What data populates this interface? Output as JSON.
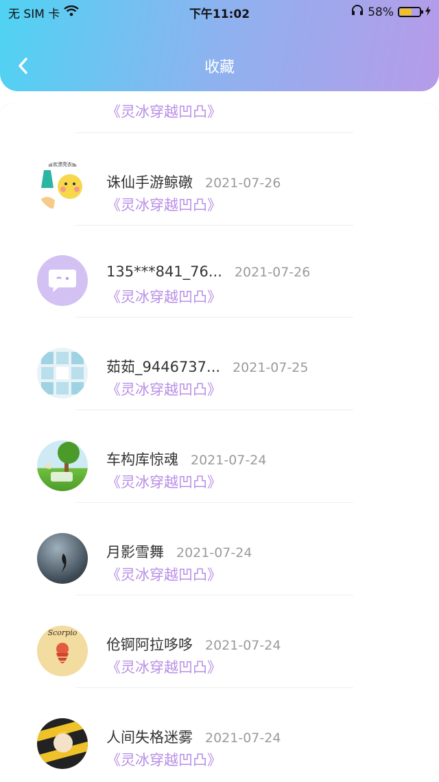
{
  "status_bar": {
    "carrier": "无 SIM 卡",
    "time": "下午11:02",
    "battery": "58%",
    "battery_level": 0.58
  },
  "header": {
    "title": "收藏"
  },
  "list": [
    {
      "name": "",
      "date": "",
      "book": "《灵冰穿越凹凸》"
    },
    {
      "name": "诛仙手游鲸礅",
      "date": "2021-07-26",
      "book": "《灵冰穿越凹凸》"
    },
    {
      "name": "135***841_76...",
      "date": "2021-07-26",
      "book": "《灵冰穿越凹凸》"
    },
    {
      "name": "茹茹_9446737...",
      "date": "2021-07-25",
      "book": "《灵冰穿越凹凸》"
    },
    {
      "name": "车构库惊魂",
      "date": "2021-07-24",
      "book": "《灵冰穿越凹凸》"
    },
    {
      "name": "月影雪舞",
      "date": "2021-07-24",
      "book": "《灵冰穿越凹凸》"
    },
    {
      "name": "伧锕阿拉哆哆",
      "date": "2021-07-24",
      "book": "《灵冰穿越凹凸》"
    },
    {
      "name": "人间失格迷雾",
      "date": "2021-07-24",
      "book": "《灵冰穿越凹凸》"
    }
  ],
  "avatar_text": {
    "item1_caption": "喜欢漂亮衣服",
    "item6_caption": "Scorpio"
  },
  "colors": {
    "header_start": "#4fd3f3",
    "header_end": "#b69be9",
    "book_link": "#b88ee6"
  }
}
